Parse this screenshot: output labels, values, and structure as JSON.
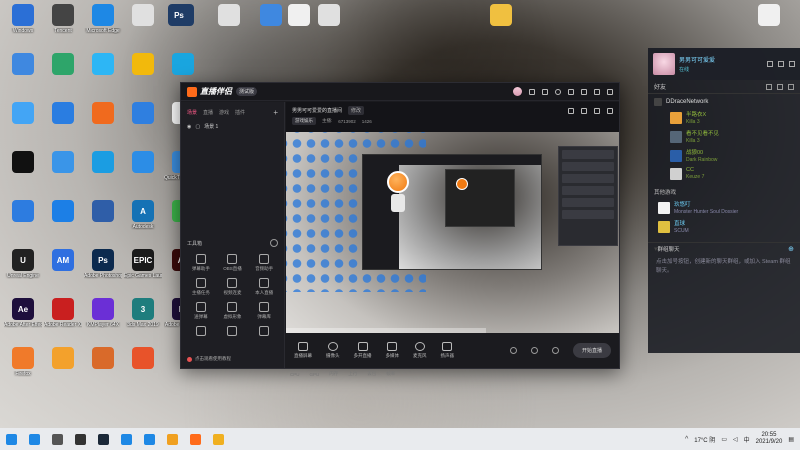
{
  "desktop": {
    "left_icons": [
      {
        "label": "Windows",
        "color": "#2b6fd6",
        "glyph": ""
      },
      {
        "label": "Tencent",
        "color": "#444444",
        "glyph": ""
      },
      {
        "label": "Microsoft Edge",
        "color": "#1e88e5",
        "glyph": ""
      },
      {
        "label": "",
        "color": "#e0e0e0",
        "glyph": ""
      },
      {
        "label": "",
        "color": "#1f3c66",
        "glyph": "Ps"
      },
      {
        "label": "",
        "color": "#3f88e0",
        "glyph": ""
      },
      {
        "label": "",
        "color": "#2ea56a",
        "glyph": ""
      },
      {
        "label": "",
        "color": "#2db6f5",
        "glyph": ""
      },
      {
        "label": "",
        "color": "#f2b90c",
        "glyph": ""
      },
      {
        "label": "",
        "color": "#1aa6e0",
        "glyph": ""
      },
      {
        "label": "",
        "color": "#43a5f5",
        "glyph": ""
      },
      {
        "label": "",
        "color": "#2a7de1",
        "glyph": ""
      },
      {
        "label": "",
        "color": "#f06a1e",
        "glyph": ""
      },
      {
        "label": "",
        "color": "#2f7fe0",
        "glyph": ""
      },
      {
        "label": "",
        "color": "#ffffff",
        "glyph": ""
      },
      {
        "label": "",
        "color": "#111111",
        "glyph": ""
      },
      {
        "label": "",
        "color": "#3a95e8",
        "glyph": ""
      },
      {
        "label": "",
        "color": "#1b9de2",
        "glyph": ""
      },
      {
        "label": "",
        "color": "#2c8de6",
        "glyph": ""
      },
      {
        "label": "QuickTime Player",
        "color": "#3b8fe0",
        "glyph": ""
      },
      {
        "label": "",
        "color": "#2d7ce0",
        "glyph": ""
      },
      {
        "label": "",
        "color": "#1c7fe6",
        "glyph": ""
      },
      {
        "label": "",
        "color": "#2f5ea8",
        "glyph": ""
      },
      {
        "label": "Autodesk",
        "color": "#1572b5",
        "glyph": "A"
      },
      {
        "label": "",
        "color": "#3cb34a",
        "glyph": ""
      },
      {
        "label": "Unreal Engine",
        "color": "#222222",
        "glyph": "U"
      },
      {
        "label": "",
        "color": "#2f6fe0",
        "glyph": "AM"
      },
      {
        "label": "Adobe Photoshop",
        "color": "#0c2a4e",
        "glyph": "Ps"
      },
      {
        "label": "Epic Games Launcher",
        "color": "#1a1a1a",
        "glyph": "EPIC"
      },
      {
        "label": "",
        "color": "#3a0a0a",
        "glyph": "An"
      },
      {
        "label": "Adobe After Effects CC",
        "color": "#1e0f3c",
        "glyph": "Ae"
      },
      {
        "label": "Adobe Reader XI",
        "color": "#c91f1f",
        "glyph": ""
      },
      {
        "label": "KMPlayer 64X",
        "color": "#6b2fd6",
        "glyph": ""
      },
      {
        "label": "3ds Max 2019",
        "color": "#1e7d7d",
        "glyph": "3"
      },
      {
        "label": "Adobe Premiere",
        "color": "#1f0f3a",
        "glyph": "Pr"
      },
      {
        "label": "Firefox",
        "color": "#f07a2a",
        "glyph": ""
      },
      {
        "label": "",
        "color": "#f3a12c",
        "glyph": ""
      },
      {
        "label": "",
        "color": "#d96a2a",
        "glyph": ""
      },
      {
        "label": "",
        "color": "#e8532a",
        "glyph": ""
      }
    ],
    "top_icons": [
      {
        "label": "",
        "color": "#1f3c66",
        "glyph": "Ps"
      },
      {
        "label": "",
        "color": "#e0e0e0",
        "glyph": ""
      },
      {
        "label": "",
        "color": "#3f88e0",
        "glyph": ""
      },
      {
        "label": "",
        "color": "#f0f0f0",
        "glyph": ""
      },
      {
        "label": "",
        "color": "#e0e0e0",
        "glyph": ""
      },
      {
        "label": "",
        "color": "#f0c040",
        "glyph": ""
      },
      {
        "label": "",
        "color": "#f0f0f0",
        "glyph": ""
      }
    ]
  },
  "app": {
    "name": "直播伴侣",
    "beta": "测试版",
    "left_tabs": [
      "场景",
      "直播",
      "游戏",
      "插件"
    ],
    "scene_name": "场景 1",
    "toolbox_title": "工具箱",
    "tools": [
      "弹幕助手",
      "OBS直播",
      "音频助手",
      "主播任务",
      "视频连麦",
      "本人直播",
      "送弹幕",
      "虚拟形象",
      "弹幕库",
      "",
      "",
      ""
    ],
    "warning": "点击观看使用教程",
    "room_title": "男男可可爱爱的直播间",
    "edit": "修改",
    "room_category": "游戏娱乐",
    "room_info": [
      "主播:",
      "6713902",
      "1426"
    ],
    "controls": [
      "直播屏幕",
      "摄像头",
      "多开直播",
      "多媒体",
      "麦克风",
      "扬声器"
    ],
    "start_live": "开始直播",
    "status": [
      "CPU",
      "GPU",
      "内存",
      "上行",
      "丢包",
      "帧率"
    ]
  },
  "steam": {
    "username": "男男可可爱爱",
    "status": "在线",
    "friends_label": "好友",
    "group_name": "DDraceNetwork",
    "group_friends": [
      {
        "name": "半路衣X",
        "game": "Killa 3",
        "color": "#e8a03a"
      },
      {
        "name": "看不见看不见",
        "game": "Killa 3",
        "color": "#556677"
      },
      {
        "name": "战狼00",
        "game": "Dark Rainbow",
        "color": "#2a5ea8"
      },
      {
        "name": "CC",
        "game": "Keuze 7",
        "color": "#d0d0d0"
      }
    ],
    "other_title": "其他游戏",
    "other_friends": [
      {
        "name": "玖悠叮",
        "game": "Monster Hunter Soul Dossier",
        "color": "#f2f2f2"
      },
      {
        "name": "直球",
        "game": "SCUM",
        "color": "#e0c040"
      }
    ],
    "chat_title": "群组聊天",
    "chat_text": "点击加号按钮，创建新的聊天群组，或加入 Steam 群组聊天。",
    "chat_link": "加入 Steam 群组聊天"
  },
  "taskbar": {
    "icons": [
      {
        "color": "#1e88e5"
      },
      {
        "color": "#555555"
      },
      {
        "color": "#333333"
      },
      {
        "color": "#1b2838"
      },
      {
        "color": "#1e88e5"
      },
      {
        "color": "#1e88e5"
      },
      {
        "color": "#f0a020"
      },
      {
        "color": "#ff6b1a"
      },
      {
        "color": "#f0b020"
      }
    ],
    "temperature": "17°C 阴",
    "time": "20:55",
    "date": "2021/9/20"
  }
}
